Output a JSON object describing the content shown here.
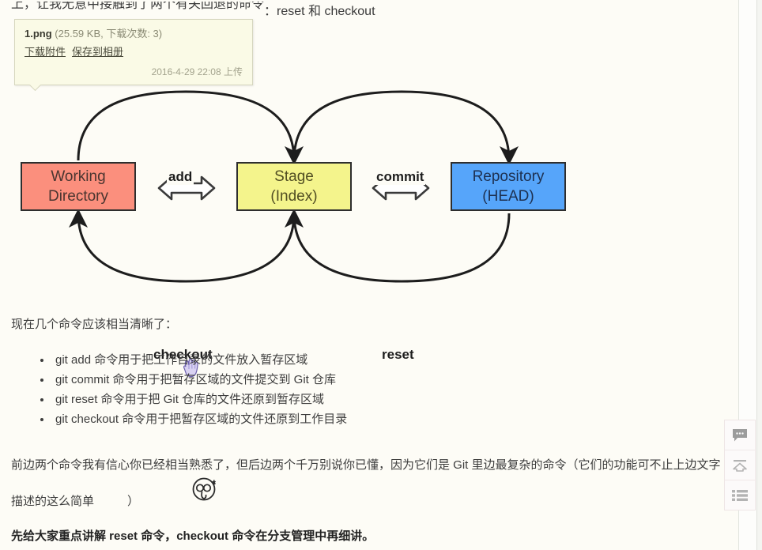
{
  "page": {
    "background_color": "#fdfcf6",
    "top_clipped_text": "上，让我无意中接触到了两个有关回退的命令",
    "top_visible_text": "：reset 和 checkout"
  },
  "attachment_tooltip": {
    "filename": "1.png",
    "meta": "(25.59 KB, 下载次数: 3)",
    "download_link": "下载附件",
    "save_link": "保存到相册",
    "upload_time": "2016-4-29 22:08 上传"
  },
  "diagram": {
    "type": "flow",
    "boxes": [
      {
        "id": "working",
        "line1": "Working",
        "line2": "Directory",
        "color": "#fb8f7d"
      },
      {
        "id": "stage",
        "line1": "Stage",
        "line2": "(Index)",
        "color": "#f4f48c"
      },
      {
        "id": "repo",
        "line1": "Repository",
        "line2": "(HEAD)",
        "color": "#56a5fa"
      }
    ],
    "arrow_labels": {
      "add": "add",
      "commit": "commit",
      "checkout": "checkout",
      "reset": "reset"
    },
    "cursor_icon": "pointing-hand-cursor"
  },
  "content": {
    "intro": "现在几个命令应该相当清晰了：",
    "commands": [
      "git add 命令用于把工作目录的文件放入暂存区域",
      "git commit 命令用于把暂存区域的文件提交到 Git 仓库",
      "git reset 命令用于把 Git 仓库的文件还原到暂存区域",
      "git checkout 命令用于把暂存区域的文件还原到工作目录"
    ],
    "paragraph_part1": "前边两个命令我有信心你已经相当熟悉了，但后边两个千万别说你已懂，因为它们是 Git 里边最复杂的命令（它们的功能可",
    "paragraph_part2": "不止上边文字描述的这么简单",
    "paragraph_part3": "）",
    "emoji": "glasses-face-emoji",
    "closing_bold": "先给大家重点讲解 reset 命令，checkout 命令在分支管理中再细讲。"
  },
  "side_widget": {
    "buttons": [
      {
        "name": "comment-icon",
        "title": "评论"
      },
      {
        "name": "back-to-top-icon",
        "title": "返回顶部"
      },
      {
        "name": "list-icon",
        "title": "返回列表"
      }
    ]
  }
}
